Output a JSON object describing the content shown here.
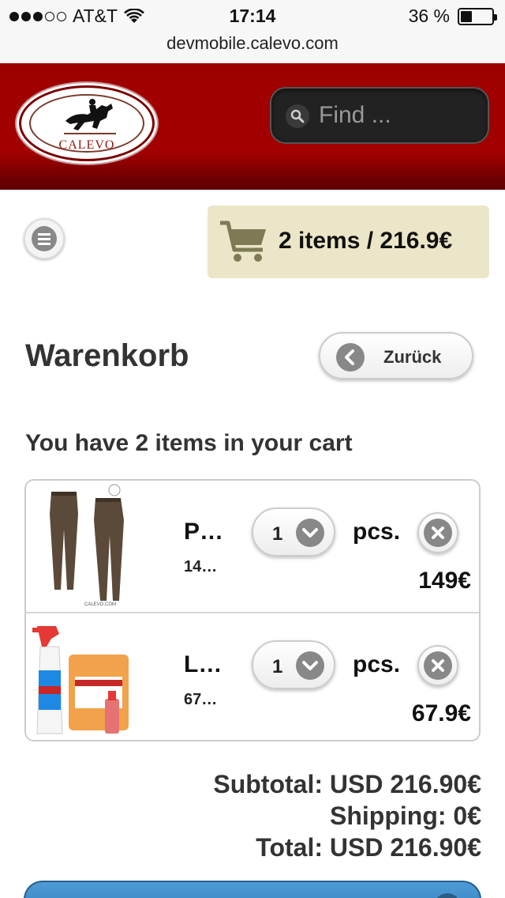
{
  "status_bar": {
    "carrier": "AT&T",
    "signal_bars_filled": 3,
    "signal_bars_total": 5,
    "time": "17:14",
    "battery_text": "36 %",
    "battery_level": 0.36
  },
  "browser": {
    "url": "devmobile.calevo.com"
  },
  "header": {
    "logo_text": "CALEVO",
    "search_placeholder": "Find ..."
  },
  "cart_summary": {
    "text": "2 items / 216.9€"
  },
  "page": {
    "title": "Warenkorb",
    "back_label": "Zurück",
    "cart_count_text": "You have 2 items in your cart"
  },
  "cart": {
    "items": [
      {
        "name": "P…",
        "sku": "14…",
        "quantity": "1",
        "unit": "pcs.",
        "price": "149€",
        "image": "breeches-image"
      },
      {
        "name": "L…",
        "sku": "67…",
        "quantity": "1",
        "unit": "pcs.",
        "price": "67.9€",
        "image": "spray-bottles-image"
      }
    ]
  },
  "totals": {
    "subtotal": "Subtotal: USD 216.90€",
    "shipping": "Shipping: 0€",
    "total": "Total: USD 216.90€"
  },
  "colors": {
    "header_red": "#a30000",
    "cart_summary_bg": "#ebe6c8",
    "checkout_blue": "#3a88c8"
  }
}
